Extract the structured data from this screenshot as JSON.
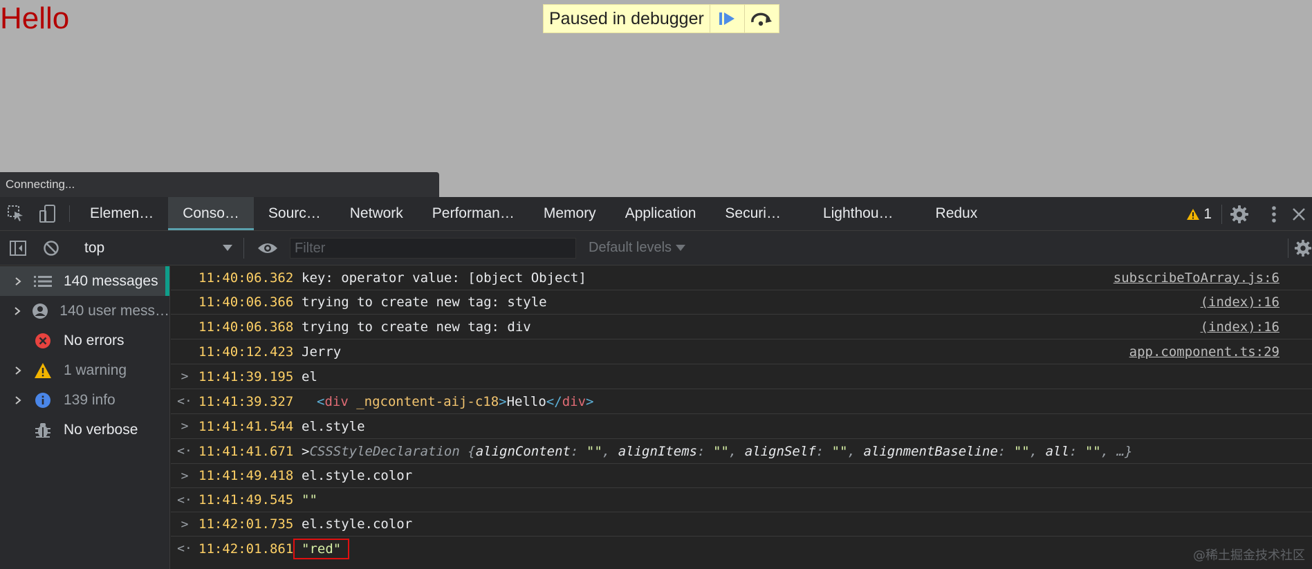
{
  "page": {
    "hello": "Hello",
    "paused_banner": {
      "text": "Paused in debugger",
      "resume_icon": "resume-icon",
      "step_over_icon": "step-over-icon"
    },
    "connecting": "Connecting..."
  },
  "tabs": [
    {
      "label": "Elemen…",
      "active": false
    },
    {
      "label": "Conso…",
      "active": true
    },
    {
      "label": "Sourc…",
      "active": false
    },
    {
      "label": "Network",
      "active": false
    },
    {
      "label": "Performan…",
      "active": false
    },
    {
      "label": "Memory",
      "active": false
    },
    {
      "label": "Application",
      "active": false
    },
    {
      "label": "Securi…",
      "active": false
    },
    {
      "label": "Lighthou…",
      "active": false
    },
    {
      "label": "Redux",
      "active": false
    }
  ],
  "warnings_count": "1",
  "toolbar": {
    "context": "top",
    "filter_placeholder": "Filter",
    "levels": "Default levels"
  },
  "sidebar": {
    "items": [
      {
        "label": "140 messages",
        "icon": "list-icon",
        "expandable": true,
        "dim": false
      },
      {
        "label": "140 user mess…",
        "icon": "user-icon",
        "expandable": true,
        "dim": true
      },
      {
        "label": "No errors",
        "icon": "error-icon",
        "expandable": false,
        "dim": false
      },
      {
        "label": "1 warning",
        "icon": "warning-icon",
        "expandable": true,
        "dim": true
      },
      {
        "label": "139 info",
        "icon": "info-icon",
        "expandable": true,
        "dim": true
      },
      {
        "label": "No verbose",
        "icon": "bug-icon",
        "expandable": false,
        "dim": false
      }
    ]
  },
  "console": {
    "rows": [
      {
        "time": "11:40:06.362",
        "text": "key: operator value: [object Object]",
        "source": "subscribeToArray.js:6"
      },
      {
        "time": "11:40:06.366",
        "text": "trying to create new tag: style",
        "source": "(index):16"
      },
      {
        "time": "11:40:06.368",
        "text": "trying to create new tag: div",
        "source": "(index):16"
      },
      {
        "time": "11:40:12.423",
        "text": "Jerry",
        "source": "app.component.ts:29"
      },
      {
        "time": "11:41:39.195",
        "text": "el",
        "arrow": ">"
      },
      {
        "time": "11:41:39.327",
        "arrow": "<·",
        "element": {
          "open": "<",
          "name": "div",
          "attr": "_ngcontent-aij-c18",
          "close": ">",
          "text": "Hello",
          "end_open": "</",
          "end_name": "div",
          "end_close": ">"
        }
      },
      {
        "time": "11:41:41.544",
        "text": "el.style",
        "arrow": ">"
      },
      {
        "time": "11:41:41.671",
        "arrow": "<·",
        "object": {
          "type": "CSSStyleDeclaration",
          "props": [
            "alignContent",
            "alignItems",
            "alignSelf",
            "alignmentBaseline",
            "all"
          ],
          "value": "\"\"",
          "more": "…}"
        }
      },
      {
        "time": "11:41:49.418",
        "text": "el.style.color",
        "arrow": ">"
      },
      {
        "time": "11:41:49.545",
        "text": "\"\"",
        "arrow": "<·"
      },
      {
        "time": "11:42:01.735",
        "text": "el.style.color",
        "arrow": ">"
      },
      {
        "time": "11:42:01.861",
        "text": "\"red\"",
        "arrow": "<·",
        "highlight": true
      }
    ]
  },
  "watermark": "@稀土掘金技术社区"
}
